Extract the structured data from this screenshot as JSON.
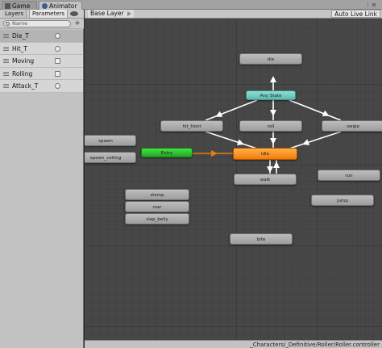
{
  "tabs": [
    {
      "label": "Game",
      "icon": "game-icon"
    },
    {
      "label": "Animator",
      "icon": "animator-icon"
    }
  ],
  "left_panel": {
    "tabs": [
      "Layers",
      "Parameters"
    ],
    "active_tab": "Parameters",
    "search": {
      "placeholder": "Name",
      "value": ""
    },
    "parameters": [
      {
        "name": "Die_T",
        "type": "trigger",
        "selected": true
      },
      {
        "name": "Hit_T",
        "type": "trigger",
        "selected": false
      },
      {
        "name": "Moving",
        "type": "bool",
        "selected": false
      },
      {
        "name": "Rolling",
        "type": "bool",
        "selected": false
      },
      {
        "name": "Attack_T",
        "type": "trigger",
        "selected": false
      }
    ]
  },
  "graph": {
    "breadcrumb": "Base Layer",
    "auto_live_link": "Auto Live Link",
    "states": {
      "die": "die",
      "any_state": "Any State",
      "hit_front": "hit_front",
      "roll": "roll",
      "swipe": "swipe",
      "spawn": "spawn",
      "spawn_ceiling": "spawn_ceiling",
      "entry": "Entry",
      "idle": "idle",
      "walk": "walk",
      "run": "run",
      "jump": "jump",
      "stomp": "stomp",
      "roar": "roar",
      "slap_belly": "slap_belly",
      "bite": "bite"
    },
    "colors": {
      "any_state": "#6fcbbf",
      "entry": "#2ec52e",
      "default_state": "#f58d1e",
      "state": "#acacac"
    }
  },
  "status_bar": {
    "path": "_Characters/_Definitive/Roller/Roller.controller"
  }
}
